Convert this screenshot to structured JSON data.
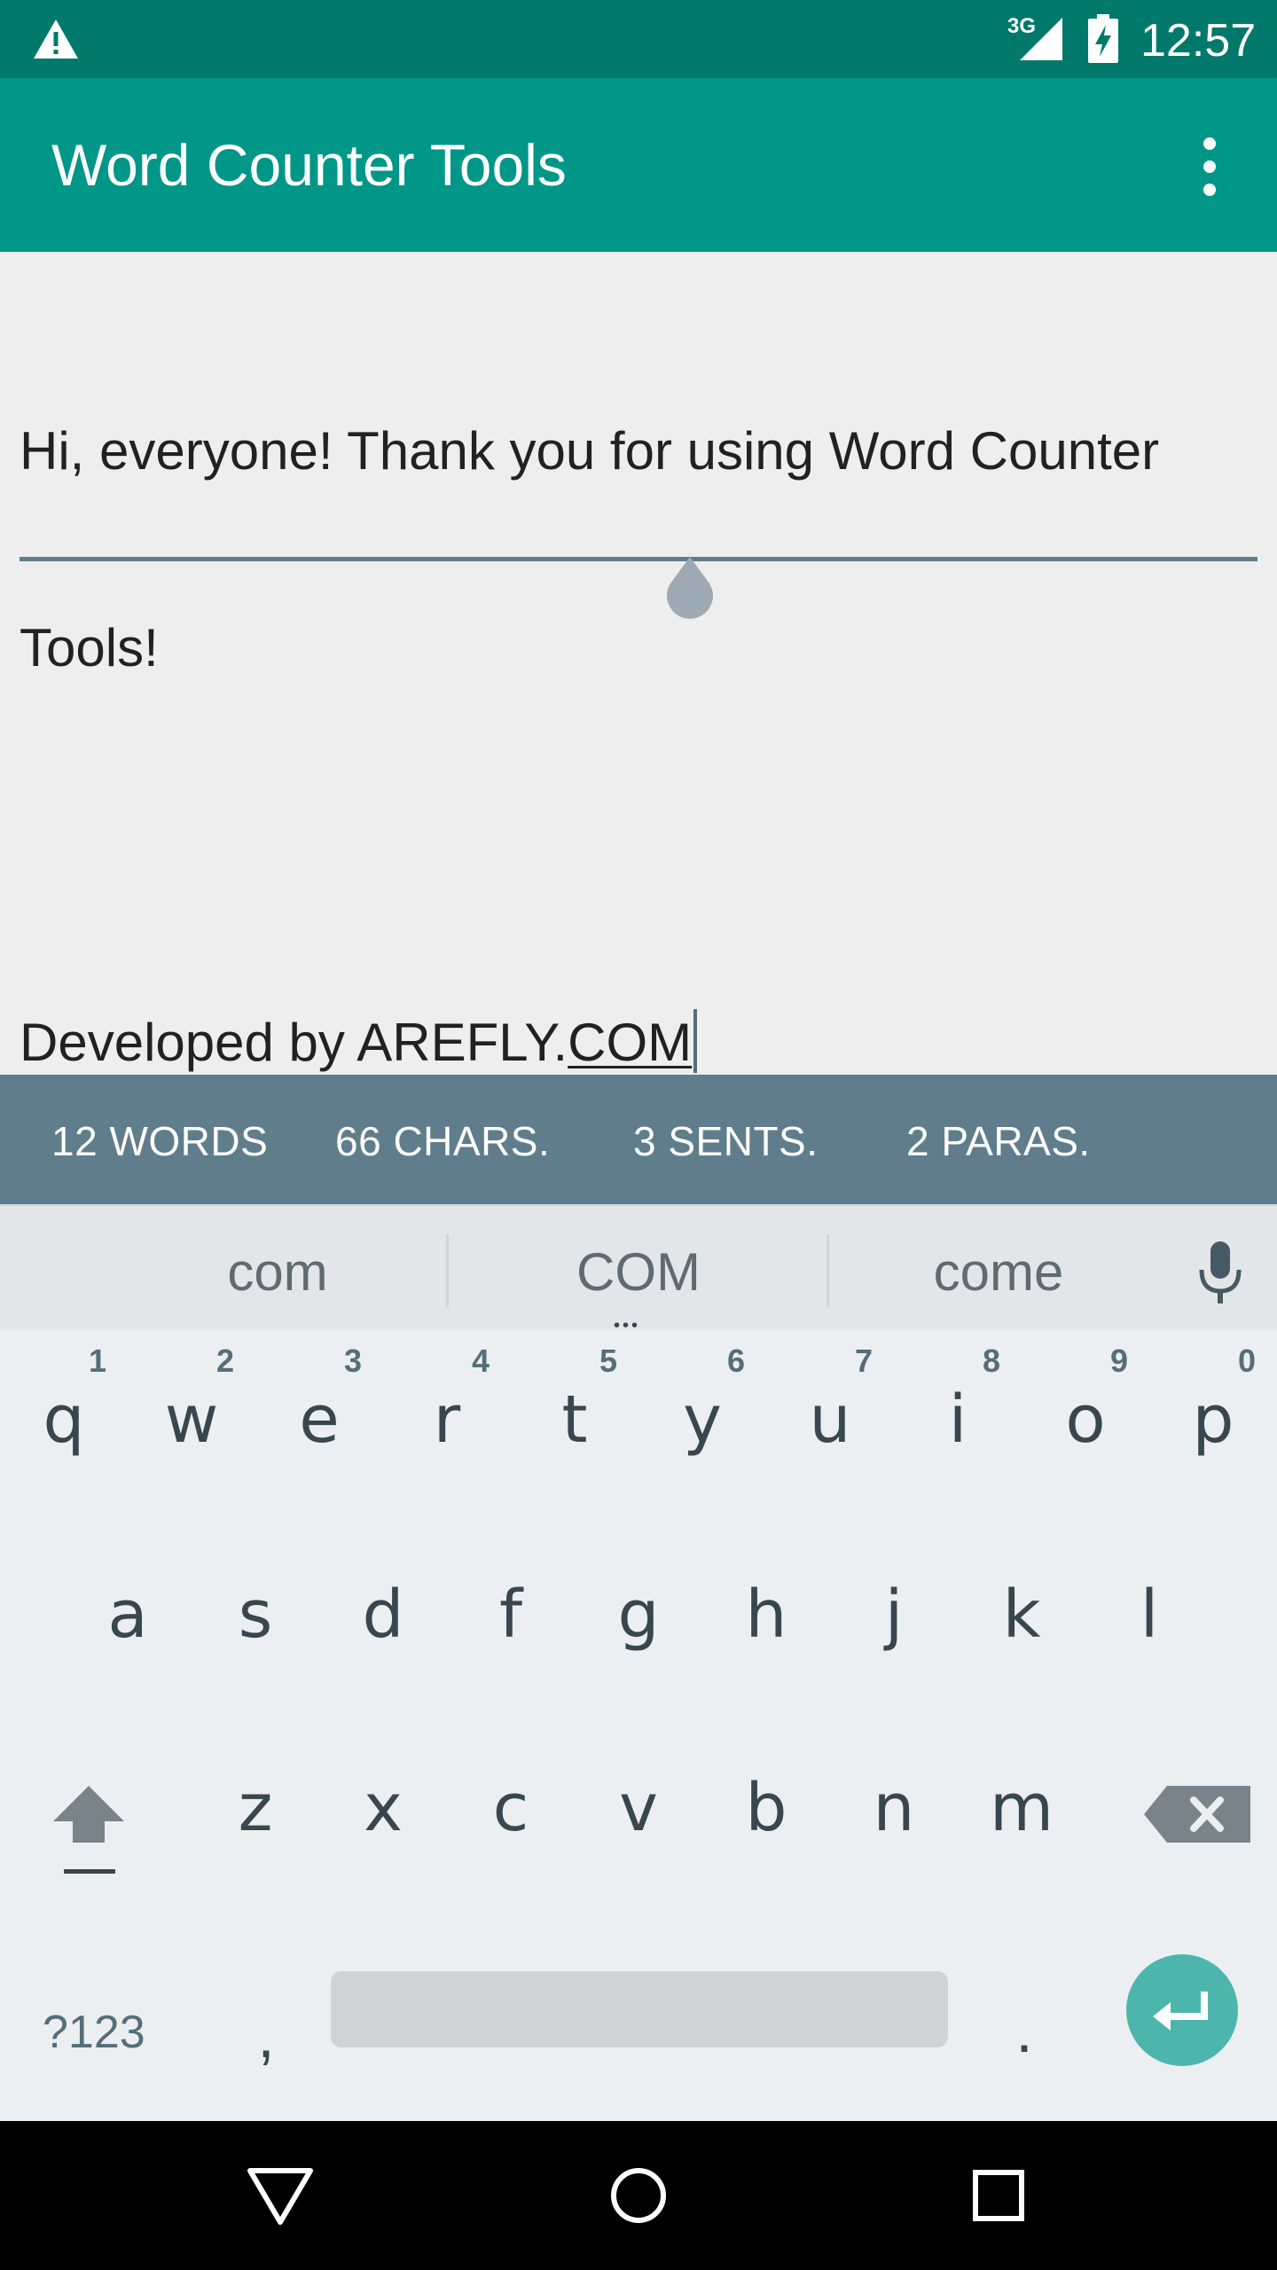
{
  "status_bar": {
    "network": "3G",
    "time": "12:57",
    "icons": [
      "warning-icon",
      "signal-icon",
      "battery-charging-icon"
    ]
  },
  "app_bar": {
    "title": "Word Counter Tools",
    "overflow_icon": "more-vert-icon"
  },
  "editor": {
    "lines": [
      "Hi, everyone! Thank you for using Word Counter",
      "Tools!",
      "",
      "Developed by AREFLY."
    ],
    "composing_word": "COM"
  },
  "stats": {
    "words": "12 WORDS",
    "chars": "66 CHARS.",
    "sentences": "3 SENTS.",
    "paragraphs": "2 PARAS."
  },
  "keyboard": {
    "suggestions": [
      "com",
      "COM",
      "come"
    ],
    "suggestion_more": "•••",
    "row1": [
      {
        "key": "q",
        "hint": "1"
      },
      {
        "key": "w",
        "hint": "2"
      },
      {
        "key": "e",
        "hint": "3"
      },
      {
        "key": "r",
        "hint": "4"
      },
      {
        "key": "t",
        "hint": "5"
      },
      {
        "key": "y",
        "hint": "6"
      },
      {
        "key": "u",
        "hint": "7"
      },
      {
        "key": "i",
        "hint": "8"
      },
      {
        "key": "o",
        "hint": "9"
      },
      {
        "key": "p",
        "hint": "0"
      }
    ],
    "row2": [
      "a",
      "s",
      "d",
      "f",
      "g",
      "h",
      "j",
      "k",
      "l"
    ],
    "row3": [
      "z",
      "x",
      "c",
      "v",
      "b",
      "n",
      "m"
    ],
    "symbols_label": "?123",
    "comma": ",",
    "period": ".",
    "accent_color": "#4db6ac"
  },
  "colors": {
    "status_bar": "#00796b",
    "app_bar": "#009688",
    "stats_bar": "#607d8b"
  }
}
